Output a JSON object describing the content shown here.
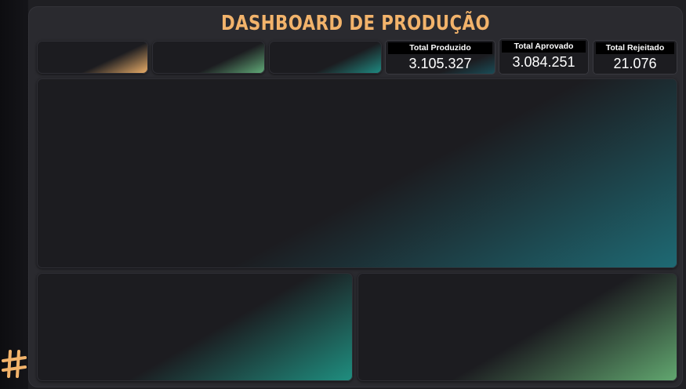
{
  "header": {
    "title": "DASHBOARD DE PRODUÇÃO"
  },
  "kpis": [
    {
      "label": "Total Produzido",
      "value": "3.105.327"
    },
    {
      "label": "Total Aprovado",
      "value": "3.084.251"
    },
    {
      "label": "Total Rejeitado",
      "value": "21.076"
    }
  ],
  "colors": {
    "accent_orange": "#f2b36b",
    "accent_green": "#64b07c",
    "accent_teal": "#1f8f86",
    "background": "#1f1f23",
    "card": "#1c1c20"
  },
  "icons": {
    "logo": "hash-logo-icon"
  }
}
